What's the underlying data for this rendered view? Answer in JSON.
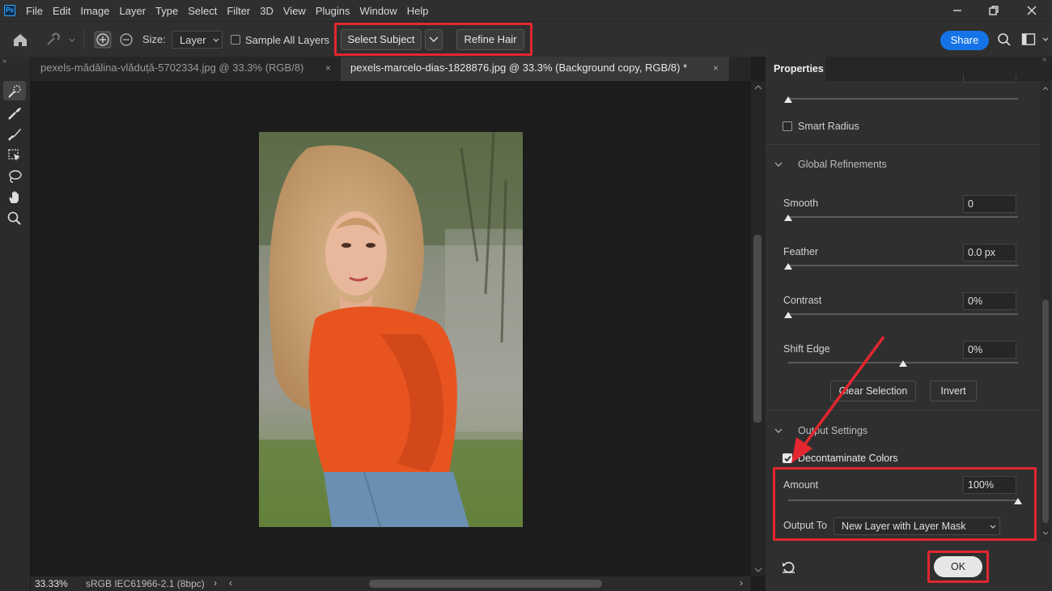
{
  "menu": [
    "File",
    "Edit",
    "Image",
    "Layer",
    "Type",
    "Select",
    "Filter",
    "3D",
    "View",
    "Plugins",
    "Window",
    "Help"
  ],
  "logo": "Ps",
  "options": {
    "size_label": "Size:",
    "size_value": "Layer",
    "sample_all_layers": "Sample All Layers",
    "select_subject": "Select Subject",
    "refine_hair": "Refine Hair",
    "share": "Share"
  },
  "tabs": [
    {
      "label": "pexels-mădălina-vlăduță-5702334.jpg @ 33.3% (RGB/8)",
      "active": false
    },
    {
      "label": "pexels-marcelo-dias-1828876.jpg @ 33.3% (Background copy, RGB/8) *",
      "active": true
    }
  ],
  "status": {
    "zoom": "33.33%",
    "profile": "sRGB IEC61966-2.1 (8bpc)"
  },
  "panel": {
    "title": "Properties",
    "smart_radius": "Smart Radius",
    "global_refinements": "Global Refinements",
    "smooth_label": "Smooth",
    "smooth_value": "0",
    "feather_label": "Feather",
    "feather_value": "0.0 px",
    "contrast_label": "Contrast",
    "contrast_value": "0%",
    "shift_edge_label": "Shift Edge",
    "shift_edge_value": "0%",
    "clear_selection": "Clear Selection",
    "invert": "Invert",
    "output_settings": "Output Settings",
    "decontaminate": "Decontaminate Colors",
    "decontaminate_checked": true,
    "amount_label": "Amount",
    "amount_value": "100%",
    "output_to_label": "Output To",
    "output_to_value": "New Layer with Layer Mask",
    "ok": "OK"
  },
  "colors": {
    "accent": "#1473e6",
    "highlight": "#e3262f",
    "sweater": "#e8541f"
  }
}
